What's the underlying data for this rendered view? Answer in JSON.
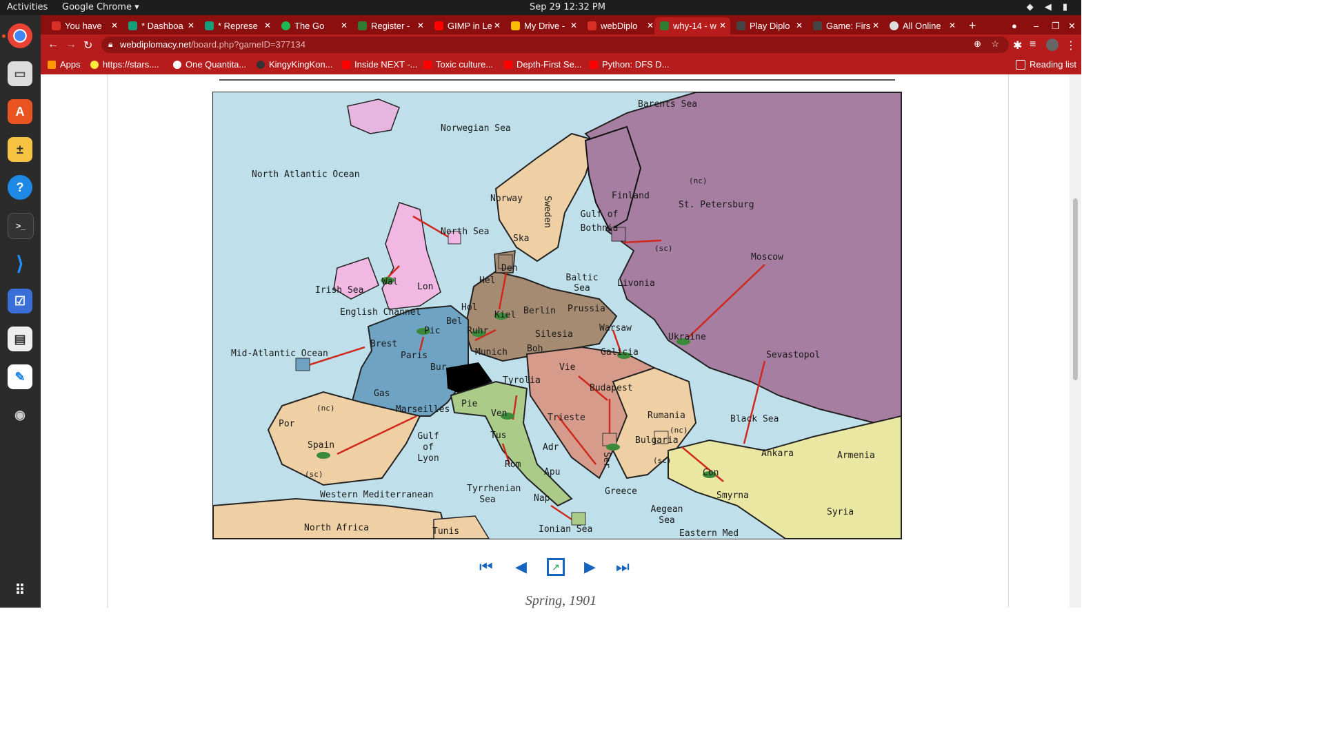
{
  "system": {
    "activities": "Activities",
    "app_menu": "Google Chrome ▾",
    "clock": "Sep 29  12:32 PM"
  },
  "tabs": [
    {
      "label": "You have",
      "fav": "#d93025"
    },
    {
      "label": "* Dashboa",
      "fav": "#15a07a"
    },
    {
      "label": "* Represe",
      "fav": "#15a07a"
    },
    {
      "label": "The Go",
      "fav": "#1db954"
    },
    {
      "label": "Register -",
      "fav": "#2e7d32"
    },
    {
      "label": "GIMP in Le",
      "fav": "#ff0000"
    },
    {
      "label": "My Drive -",
      "fav": "#fbbc04"
    },
    {
      "label": "webDiplo",
      "fav": "#d93025"
    },
    {
      "label": "why-14 - w",
      "fav": "#2e7d32"
    },
    {
      "label": "Play Diplo",
      "fav": "#444444"
    },
    {
      "label": "Game: Firs",
      "fav": "#444444"
    },
    {
      "label": "All Online",
      "fav": "#dddddd"
    }
  ],
  "address_bar": {
    "host": "webdiplomacy.net",
    "path": "/board.php?gameID=377134"
  },
  "bookmarks": [
    {
      "label": "Apps",
      "color": "#ff9800"
    },
    {
      "label": "https://stars....",
      "color": "#ffeb3b"
    },
    {
      "label": "One Quantita...",
      "color": "#ffffff"
    },
    {
      "label": "KingyKingKon...",
      "color": "#333333"
    },
    {
      "label": "Inside NEXT -...",
      "color": "#ff0000"
    },
    {
      "label": "Toxic culture...",
      "color": "#ff0000"
    },
    {
      "label": "Depth-First Se...",
      "color": "#ff0000"
    },
    {
      "label": "Python: DFS D...",
      "color": "#ff0000"
    }
  ],
  "reading_list": "Reading list",
  "map_labels": [
    "Barents Sea",
    "Norwegian Sea",
    "North Atlantic Ocean",
    "Norway",
    "Sweden",
    "Finland",
    "St. Petersburg",
    "(nc)",
    "Gulf of Bothnia",
    "North Sea",
    "Ska",
    "Den",
    "Baltic Sea",
    "Livonia",
    "Moscow",
    "(sc)",
    "Irish Sea",
    "Wal",
    "Lon",
    "Hel",
    "Kiel",
    "Berlin",
    "Prussia",
    "Hol",
    "English Channel",
    "Bel",
    "Ruhr",
    "Silesia",
    "Warsaw",
    "Ukraine",
    "Pic",
    "Brest",
    "Paris",
    "Munich",
    "Boh",
    "Galicia",
    "Sevastopol",
    "Mid-Atlantic Ocean",
    "Bur",
    "Tyrolia",
    "Vie",
    "Budapest",
    "Gas",
    "(nc)",
    "Marseilles",
    "Pie",
    "Ven",
    "Trieste",
    "Rumania",
    "Black Sea",
    "Por",
    "Spain",
    "Gulf of Lyon",
    "Tus",
    "Adr",
    "Bulgaria",
    "(nc)",
    "Ser",
    "Ankara",
    "Armenia",
    "Rom",
    "(sc)",
    "Con",
    "(sc)",
    "Apu",
    "Smyrna",
    "Western Mediterranean",
    "Tyrrhenian Sea",
    "Nap",
    "Greece",
    "Aegean Sea",
    "Syria",
    "North Africa",
    "Tunis",
    "Ionian Sea",
    "Eastern Med"
  ],
  "season": "Spring, 1901"
}
